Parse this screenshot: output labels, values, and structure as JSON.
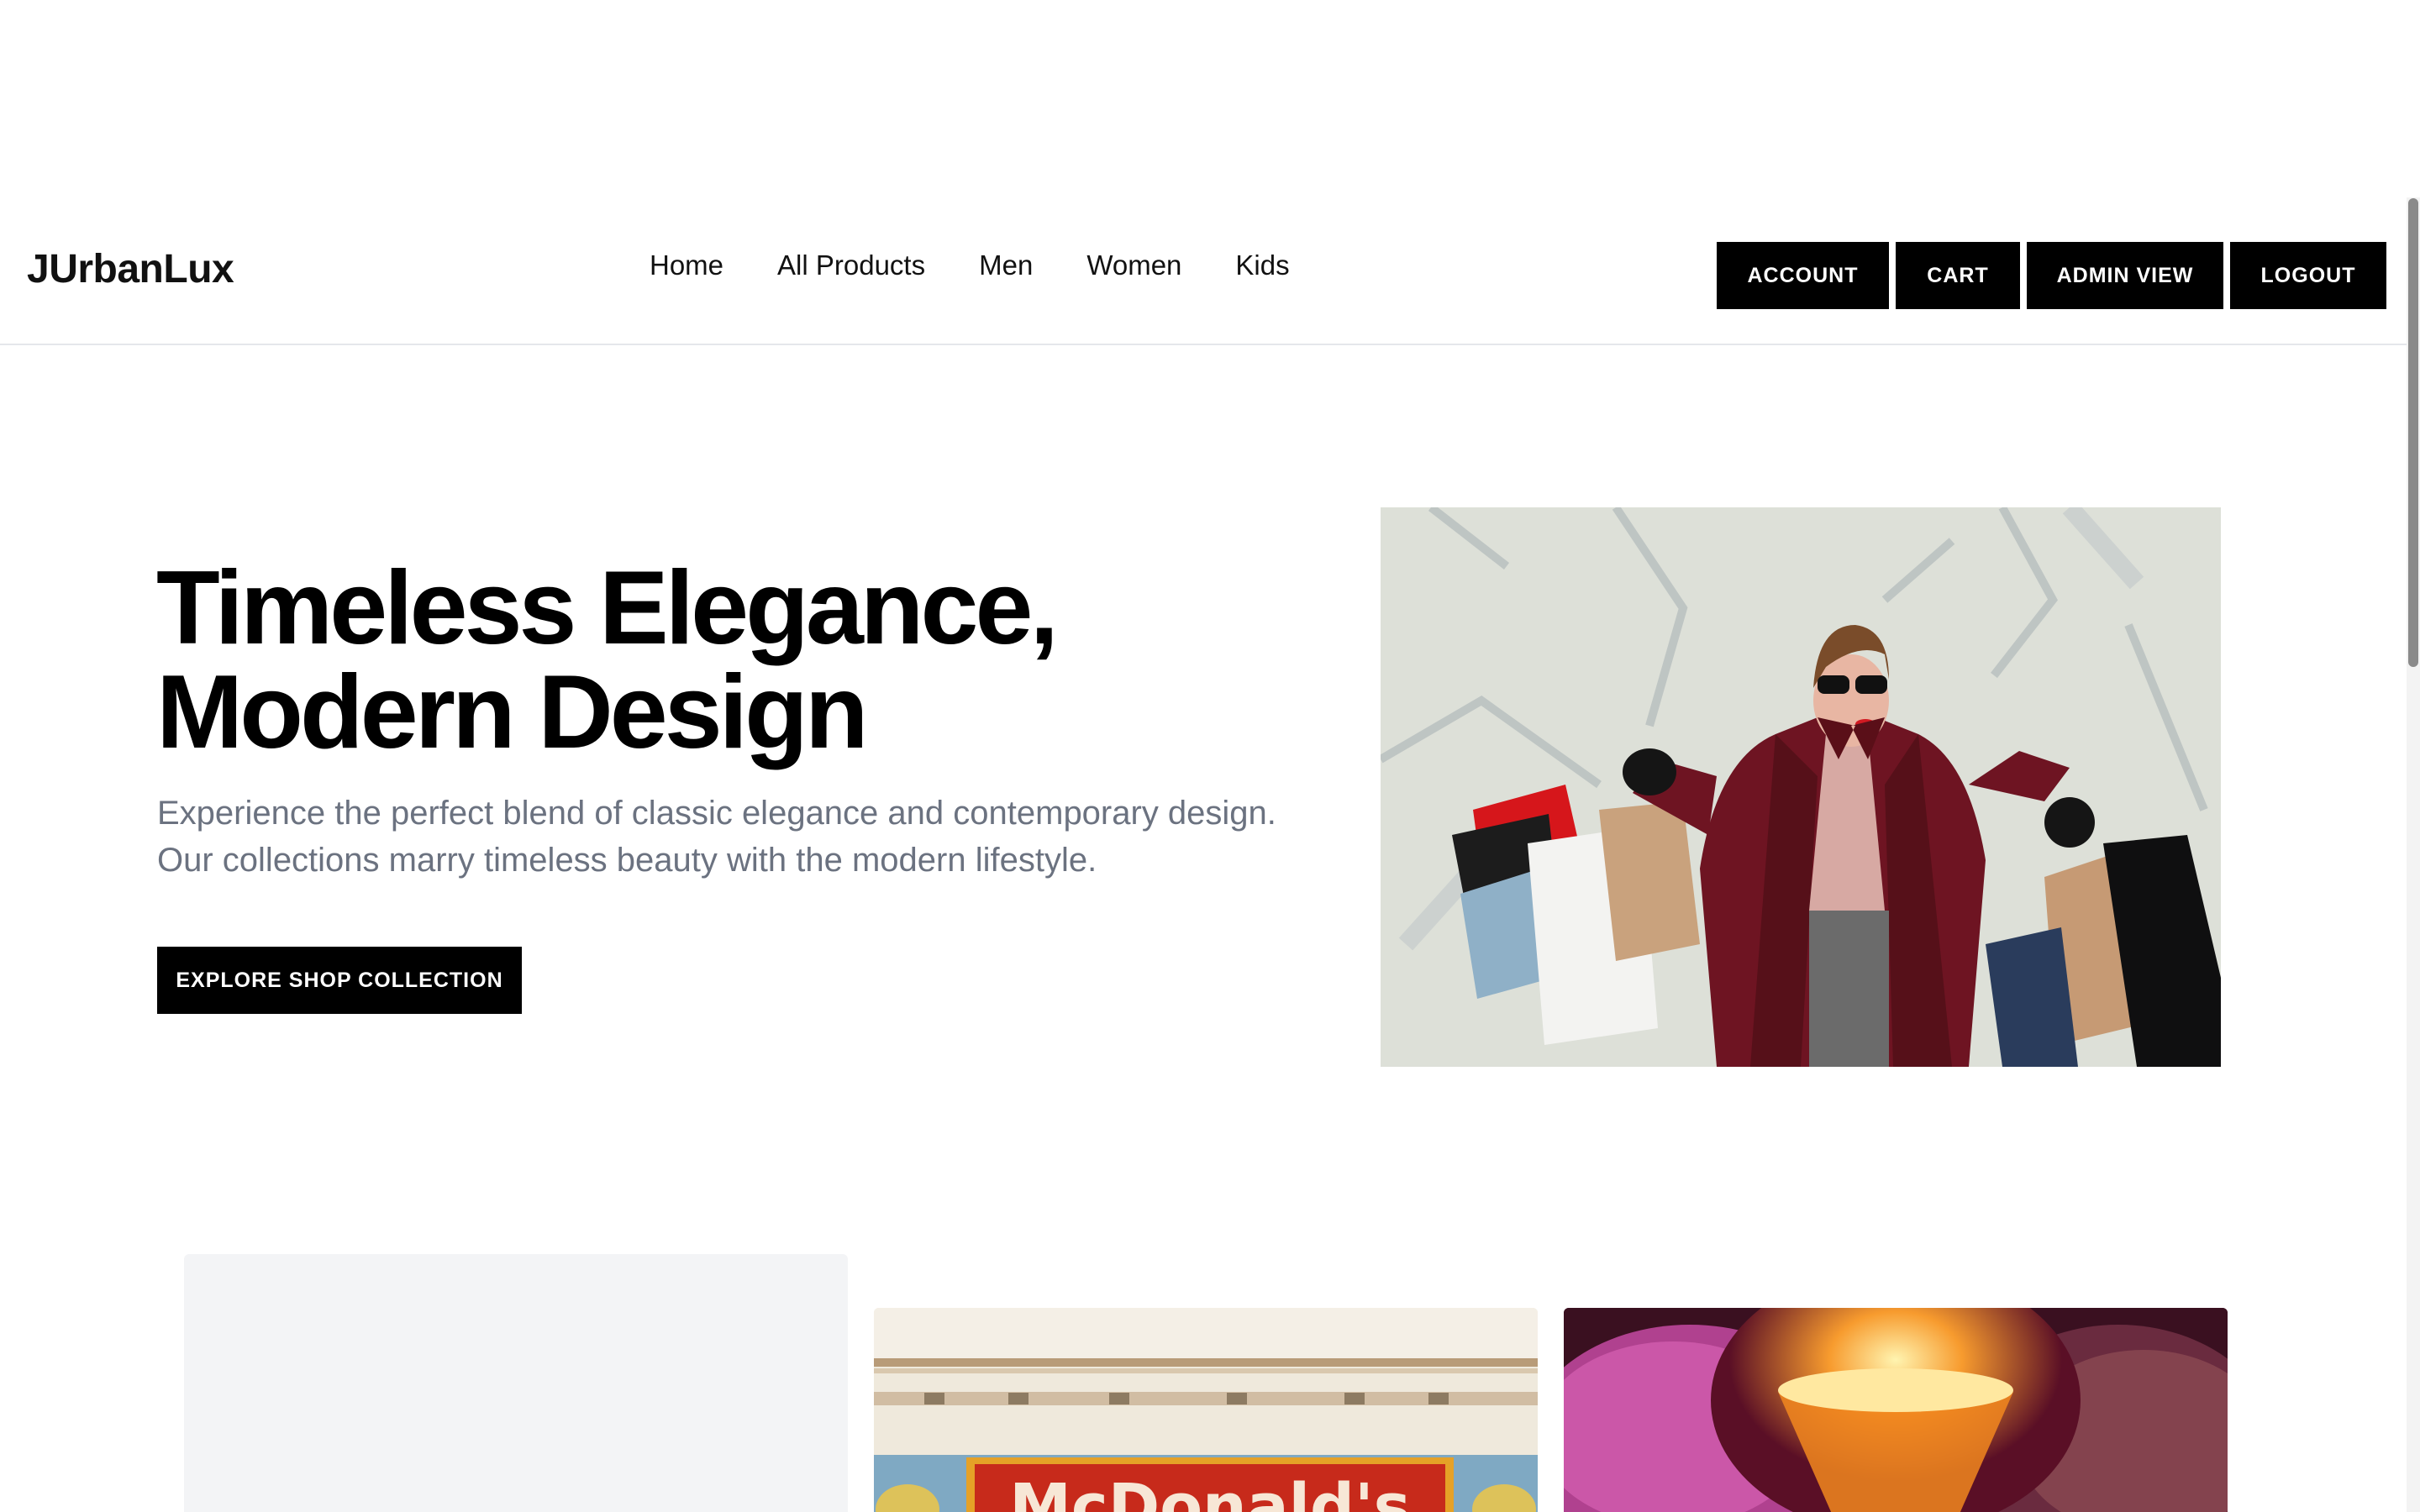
{
  "brand": {
    "name": "JUrbanLux"
  },
  "nav": {
    "items": [
      {
        "label": "Home"
      },
      {
        "label": "All Products"
      },
      {
        "label": "Men"
      },
      {
        "label": "Women"
      },
      {
        "label": "Kids"
      }
    ]
  },
  "header_actions": {
    "account": "ACCOUNT",
    "cart": "CART",
    "admin_view": "ADMIN VIEW",
    "logout": "LOGOUT"
  },
  "hero": {
    "title_line1": "Timeless Elegance,",
    "title_line2": "Modern Design",
    "subtitle": "Experience the perfect blend of classic elegance and contemporary design. Our collections marry timeless beauty with the modern lifestyle.",
    "cta": "EXPLORE SHOP COLLECTION",
    "image_icon": "woman-shopping-bags-photo"
  },
  "collections": {
    "card_2_sign_text": "McDonald's",
    "card_2_icon": "mcdonalds-storefront-photo",
    "card_3_icon": "glowing-lamp-photo"
  },
  "colors": {
    "button_bg": "#000000",
    "button_text": "#ffffff",
    "subtitle_text": "#6b7280",
    "divider": "#e5e7eb",
    "placeholder_card": "#f3f4f6"
  }
}
